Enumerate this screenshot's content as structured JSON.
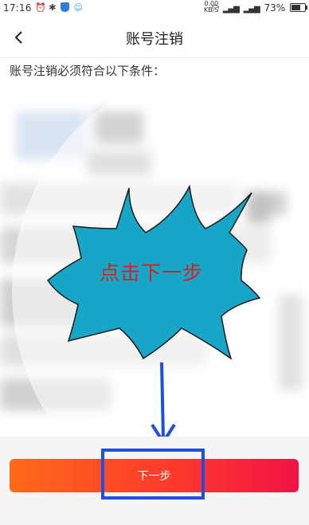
{
  "status_bar": {
    "time": "17:16",
    "speed_top": "0.00",
    "speed_unit": "KB/S",
    "battery": "73%"
  },
  "header": {
    "title": "账号注销",
    "back_icon": "chevron-left-icon"
  },
  "notice": "账号注销必须符合以下条件：",
  "callout": {
    "text": "点击下一步",
    "fill": "#17a6c8",
    "text_color": "#e21b1b"
  },
  "footer": {
    "next_label": "下一步",
    "button_gradient": [
      "#ff6a1a",
      "#f21346"
    ],
    "highlight_color": "#1d4fe8"
  }
}
